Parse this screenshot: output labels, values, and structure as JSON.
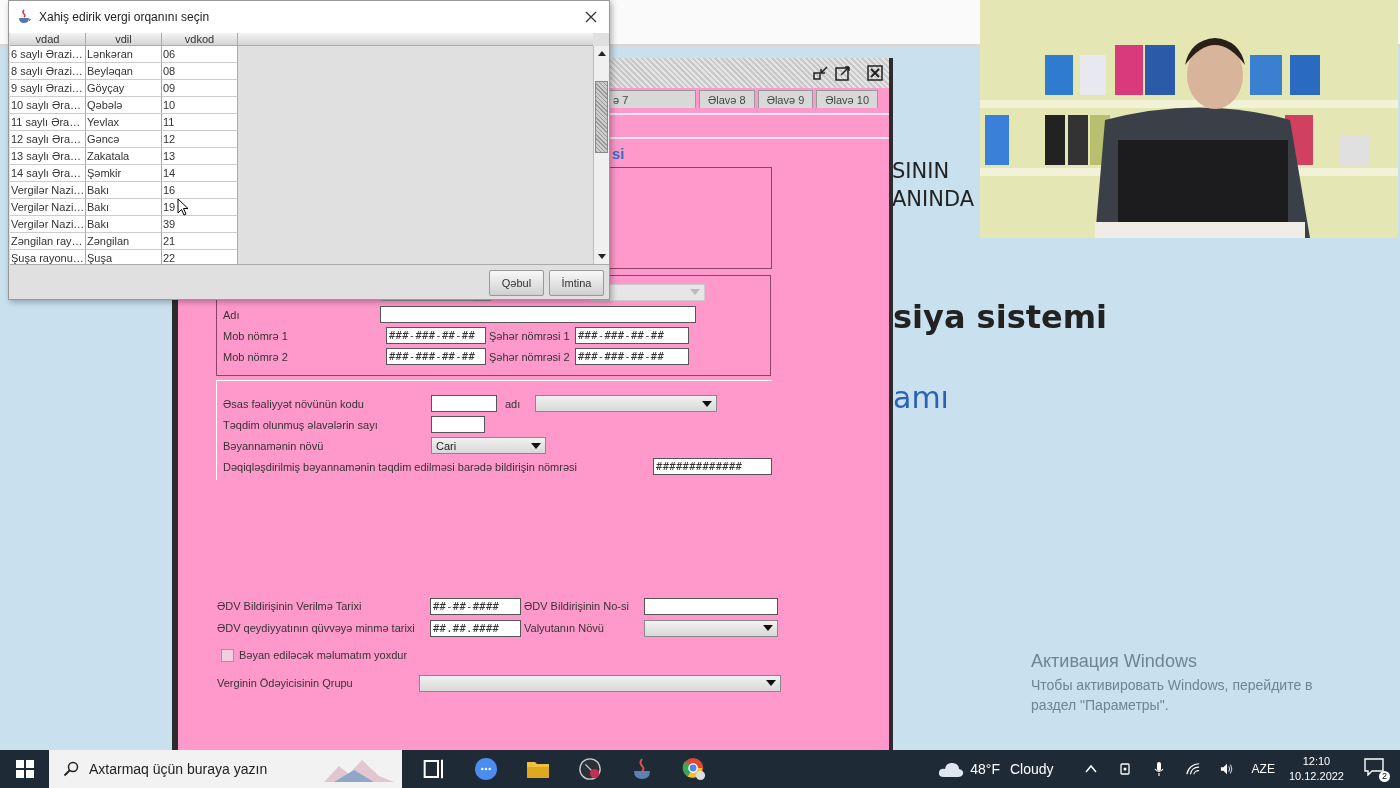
{
  "slide": {
    "heading_line_1": "SININ",
    "heading_line_2": "ANINDA",
    "title": "siya sistemi",
    "subtitle": "amı"
  },
  "app_window": {
    "tabs": [
      {
        "label": "ə 7",
        "selected": false
      },
      {
        "label": "Əlavə 8",
        "selected": false
      },
      {
        "label": "Əlavə 9",
        "selected": false
      },
      {
        "label": "Əlavə 10",
        "selected": false
      }
    ],
    "heading": "si",
    "contact_box": {
      "type_dropdown": {
        "disabled": true
      },
      "name_label": "Adı",
      "mob_1_label": "Mob nömrə 1",
      "mob_1_value": "###-###-##-##",
      "city_1_label": "Şəhər nömrəsi 1",
      "city_1_value": "###-###-##-##",
      "mob_2_label": "Mob nömrə 2",
      "mob_2_value": "###-###-##-##",
      "city_2_label": "Şəhər nömrəsi 2",
      "city_2_value": "###-###-##-##"
    },
    "activity_box": {
      "code_label": "Əsas fəaliyyət növünün kodu",
      "name_label": "adı",
      "count_label": "Təqdim olunmuş əlavələrin sayı",
      "type_label": "Bəyannamənin növü",
      "type_value": "Cari",
      "notice_label": "Dəqiqləşdirilmiş bəyannamənin təqdim edilməsi barədə bildirişin nömrəsi",
      "notice_value": "#############"
    },
    "vat": {
      "date_label": "ƏDV Bildirişinin Verilmə Tarixi",
      "date_value": "##-##-####",
      "number_label": "ƏDV Bildirişinin No-si",
      "effective_label": "ƏDV qeydiyyatının qüvvəyə minmə tarixi",
      "effective_value": "##.##.####",
      "currency_label": "Valyutanın Növü",
      "no_info_label": "Bəyan ediləcək məlumatım yoxdur",
      "no_info_checked": false,
      "group_label": "Verginin Ödəyicisinin Qrupu"
    }
  },
  "dialog": {
    "title": "Xahiş edirik vergi orqanını seçin",
    "columns": [
      "vdad",
      "vdil",
      "vdkod"
    ],
    "rows": [
      [
        "6 saylı Ərazi…",
        "Lənkəran",
        "06"
      ],
      [
        "8 saylı Ərazi…",
        "Beyləqan",
        "08"
      ],
      [
        "9 saylı Ərazi…",
        "Göyçay",
        "09"
      ],
      [
        "10 saylı Əra…",
        "Qəbələ",
        "10"
      ],
      [
        "11 saylı Əra…",
        "Yevlax",
        "11"
      ],
      [
        "12 saylı Əra…",
        "Gəncə",
        "12"
      ],
      [
        "13 saylı Əra…",
        "Zakatala",
        "13"
      ],
      [
        "14 saylı Əra…",
        "Şəmkir",
        "14"
      ],
      [
        "Vergilər Nazi…",
        "Bakı",
        "16"
      ],
      [
        "Vergilər Nazi…",
        "Bakı",
        "19"
      ],
      [
        "Vergilər Nazi…",
        "Bakı",
        "39"
      ],
      [
        "Zəngilan ray…",
        "Zəngilan",
        "21"
      ],
      [
        "Şuşa rayonu…",
        "Şuşa",
        "22"
      ]
    ],
    "buttons": [
      "Qəbul",
      "İmtina"
    ]
  },
  "activation": {
    "title": "Активация Windows",
    "text": "Чтобы активировать Windows, перейдите в раздел \"Параметры\"."
  },
  "taskbar": {
    "search_placeholder": "Axtarmaq üçün buraya yazın",
    "temperature": "48°F",
    "weather": "Cloudy",
    "language": "AZE",
    "time": "12:10",
    "date": "10.12.2022",
    "notifications": "2"
  }
}
